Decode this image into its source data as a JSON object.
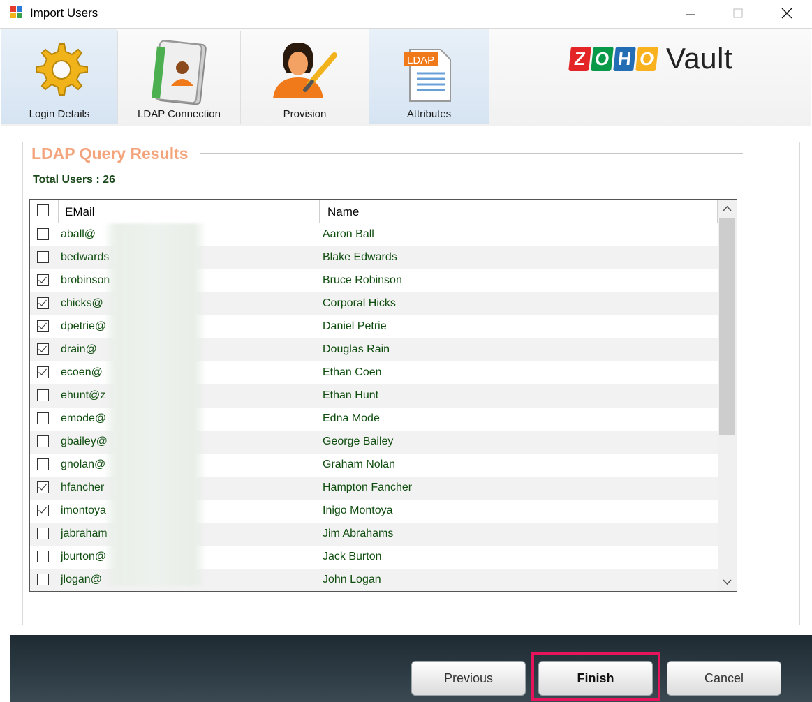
{
  "window": {
    "title": "Import Users",
    "controls": [
      "minimize-icon",
      "maximize-icon",
      "close-icon"
    ]
  },
  "toolbar": {
    "items": [
      {
        "label": "Login Details",
        "icon": "gear-icon",
        "active": true
      },
      {
        "label": "LDAP Connection",
        "icon": "address-book-icon",
        "active": false
      },
      {
        "label": "Provision",
        "icon": "user-wrench-icon",
        "active": false
      },
      {
        "label": "Attributes",
        "icon": "ldap-document-icon",
        "active": true
      }
    ],
    "brand": {
      "letters": [
        "Z",
        "O",
        "H",
        "O"
      ],
      "letter_colors": [
        "#e42527",
        "#089949",
        "#226db4",
        "#f9b21d"
      ],
      "product": "Vault"
    }
  },
  "results": {
    "title": "LDAP Query Results",
    "total_label": "Total Users : 26",
    "columns": {
      "email": "EMail",
      "name": "Name"
    },
    "rows": [
      {
        "email": "aball@",
        "name": "Aaron Ball",
        "checked": false
      },
      {
        "email": "bedwards",
        "name": "Blake Edwards",
        "checked": false
      },
      {
        "email": "brobinson",
        "name": "Bruce Robinson",
        "checked": true
      },
      {
        "email": "chicks@",
        "name": "Corporal Hicks",
        "checked": true
      },
      {
        "email": "dpetrie@",
        "name": "Daniel Petrie",
        "checked": true
      },
      {
        "email": "drain@",
        "name": "Douglas Rain",
        "checked": true
      },
      {
        "email": "ecoen@",
        "name": "Ethan Coen",
        "checked": true
      },
      {
        "email": "ehunt@z",
        "name": "Ethan Hunt",
        "checked": false
      },
      {
        "email": "emode@",
        "name": "Edna Mode",
        "checked": false
      },
      {
        "email": "gbailey@",
        "name": "George Bailey",
        "checked": false
      },
      {
        "email": "gnolan@",
        "name": "Graham Nolan",
        "checked": false
      },
      {
        "email": "hfancher",
        "name": "Hampton Fancher",
        "checked": true
      },
      {
        "email": "imontoya",
        "name": "Inigo Montoya",
        "checked": true
      },
      {
        "email": "jabraham",
        "name": "Jim Abrahams",
        "checked": false
      },
      {
        "email": "jburton@",
        "name": "Jack Burton",
        "checked": false
      },
      {
        "email": "jlogan@",
        "name": "John Logan",
        "checked": false
      }
    ]
  },
  "footer": {
    "previous": "Previous",
    "finish": "Finish",
    "cancel": "Cancel",
    "highlight_color": "#e6145a"
  }
}
